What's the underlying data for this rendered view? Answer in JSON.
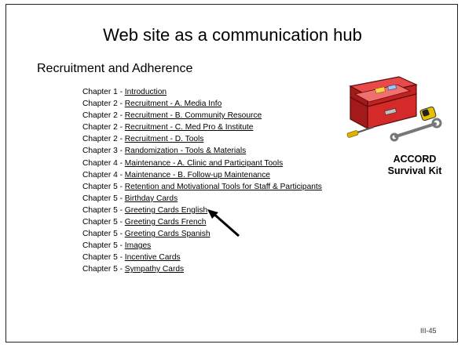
{
  "slide": {
    "title": "Web site as a communication hub",
    "subtitle": "Recruitment and Adherence",
    "chapters": [
      {
        "prefix": "Chapter 1 - ",
        "link": "Introduction"
      },
      {
        "prefix": "Chapter 2 - ",
        "link": "Recruitment - A. Media Info"
      },
      {
        "prefix": "Chapter 2 - ",
        "link": "Recruitment - B. Community Resource"
      },
      {
        "prefix": "Chapter 2 - ",
        "link": "Recruitment - C. Med Pro & Institute"
      },
      {
        "prefix": "Chapter 2 - ",
        "link": "Recruitment - D. Tools"
      },
      {
        "prefix": "Chapter 3 - ",
        "link": "Randomization - Tools & Materials"
      },
      {
        "prefix": "Chapter 4 - ",
        "link": "Maintenance - A. Clinic and Participant Tools"
      },
      {
        "prefix": "Chapter 4 - ",
        "link": "Maintenance - B. Follow-up Maintenance"
      },
      {
        "prefix": "Chapter 5 - ",
        "link": "Retention and Motivational Tools for Staff & Participants"
      },
      {
        "prefix": "Chapter 5 - ",
        "link": "Birthday Cards"
      },
      {
        "prefix": "Chapter 5 - ",
        "link": "Greeting Cards English"
      },
      {
        "prefix": "Chapter 5 - ",
        "link": "Greeting Cards French"
      },
      {
        "prefix": "Chapter 5 - ",
        "link": "Greeting Cards Spanish"
      },
      {
        "prefix": "Chapter 5 - ",
        "link": "Images"
      },
      {
        "prefix": "Chapter 5 - ",
        "link": "Incentive Cards"
      },
      {
        "prefix": "Chapter 5 - ",
        "link": "Sympathy Cards"
      }
    ],
    "kit_label_line1": "ACCORD",
    "kit_label_line2": "Survival Kit",
    "page_number": "III-45",
    "icons": [
      "toolbox-icon",
      "arrow-pointer-icon"
    ],
    "colors": {
      "toolbox_red": "#d42a2a",
      "toolbox_dark": "#8a1414",
      "text": "#000000",
      "background": "#ffffff"
    }
  }
}
